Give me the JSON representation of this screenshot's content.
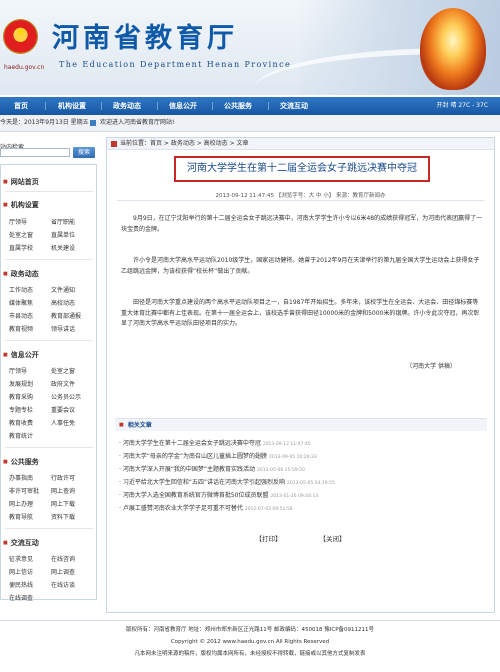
{
  "header": {
    "title": "河南省教育厅",
    "subtitle": "The Education Department Henan Province",
    "url": "haedu.gov.cn"
  },
  "nav": {
    "items": [
      "首页",
      "机构设置",
      "政务动态",
      "信息公开",
      "公共服务",
      "交流互动"
    ],
    "weather": "开封 晴 27C - 37C"
  },
  "infobar": {
    "date": "今天是：2013年9月13日 星期五",
    "greeting": "欢迎进入河南省教育厅网站!"
  },
  "sidebar": {
    "search_title": "站内检索",
    "search_placeholder": "",
    "search_button": "搜索",
    "sections": [
      {
        "title": "网站首页",
        "links": []
      },
      {
        "title": "机构设置",
        "links": [
          "厅领导",
          "省厅职能",
          "处室之窗",
          "直属单位",
          "直属学校",
          "机关建设"
        ]
      },
      {
        "title": "政务动态",
        "links": [
          "工作动态",
          "文件通知",
          "媒体聚焦",
          "高校动态",
          "市县动态",
          "教育部通报",
          "教育视频",
          "领导讲话"
        ]
      },
      {
        "title": "信息公开",
        "links": [
          "厅领导",
          "处室之窗",
          "发展规划",
          "政府文件",
          "教育采购",
          "公务员公示",
          "专题专栏",
          "重要会议",
          "教育收费",
          "人事任免",
          "教育统计"
        ]
      },
      {
        "title": "公共服务",
        "links": [
          "办事指南",
          "行政许可",
          "非许可审批",
          "网上查询",
          "网上办理",
          "网上下载",
          "教育导航",
          "资料下载"
        ]
      },
      {
        "title": "交流互动",
        "links": [
          "征求意见",
          "在线咨询",
          "网上信访",
          "网上调查",
          "便民热线",
          "在线访谈",
          "在线调查"
        ]
      }
    ]
  },
  "article": {
    "breadcrumb": "当前位置：首页 > 政务动态 > 高校动态 > 文章",
    "title": "河南大学学生在第十二届全运会女子跳远决赛中夺冠",
    "meta": "2013-09-12 11:47:45 【浏览字号：大 中 小】 来源：教育厅新闻办",
    "paragraphs": [
      "9月9日，在辽宁沈阳举行的第十二届全运会女子跳远决赛中，河南大学学生许小令以6米48的成绩获得冠军，为河南代表团赢得了一块宝贵的金牌。",
      "许小令是河南大学高水平运动队2010级学生，国家运动健将。她曾于2012年9月在天津举行的第九届全国大学生运动会上获得女子乙组跳远金牌，为该校获得“校长杯”做出了贡献。",
      "田径是河南大学重点建设的两个高水平运动队项目之一，自1987年开始招生。多年来，该校学生在全运会、大运会、田径锦标赛等重大体育比赛中都有上佳表现。在第十一届全运会上，该校选手曾获得田径10000米的金牌和5000米的银牌。许小令此次夺冠，再次彰显了河南大学高水平运动队田径项目的实力。"
    ],
    "source": "（河南大学  供稿）",
    "related_title": "相关文章",
    "related": [
      {
        "text": "· 河南大学学生在第十二届全运会女子跳远决赛中夺冠",
        "date": "2013-09-12 11:47:45"
      },
      {
        "text": "· 河南大学“母亲的学金”为南召山区儿童插上圆梦的翅膀",
        "date": "2013-09-05 10:29:33"
      },
      {
        "text": "· 河南大学深入开展“我的中国梦”主题教育实践活动",
        "date": "2013-05-06 15:59:50"
      },
      {
        "text": "· 习近平给北大学生回信和“五四”讲话在河南大学引起强烈反响",
        "date": "2013-05-05 14:19:55"
      },
      {
        "text": "· 河南大学入选全国教育系统官方微博首批50位成员联盟",
        "date": "2013-01-26 09:44:13"
      },
      {
        "text": "· 卢展工盛赞河南农业大学学子足可重不可替代",
        "date": "2012-07-03 09:51:58"
      }
    ],
    "print_label": "【打印】",
    "close_label": "【关闭】"
  },
  "footer": {
    "line1": "版权所有：河南省教育厅  地址：郑州市郑东新区正光路11号  邮政编码：450018 豫ICP备0911211号",
    "line2": "Copyright © 2012 www.haedu.gov.cn All Rights Reserved",
    "line3": "凡本网未注明来源的稿件，版权均属本网所有，未经授权不得转载，链接或以其他方式复制发表"
  }
}
